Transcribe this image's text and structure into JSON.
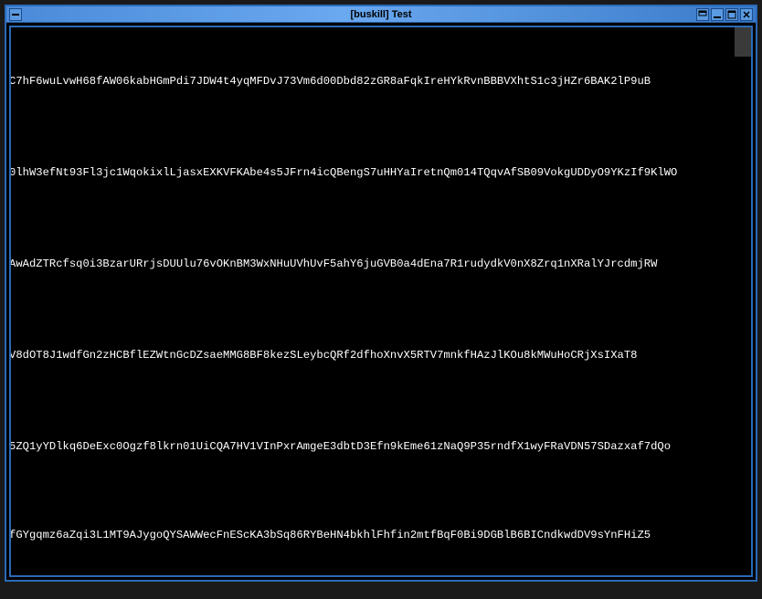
{
  "window": {
    "title": "[buskill] Test"
  },
  "content": {
    "lines": [
      "C7hF6wuLvwH68fAW06kabHGmPdi7JDW4t4yqMFDvJ73Vm6d00Dbd82zGR8aFqkIreHYkRvnBBBVXhtS1c3jHZr6BAK2lP9uB",
      "0lhW3efNt93Fl3jc1WqokixlLjasxEXKVFKAbe4s5JFrn4icQBengS7uHHYaIretnQm014TQqvAfSB09VokgUDDyO9YKzIf9KlWO",
      "AwAdZTRcfsq0i3BzarURrjsDUUlu76vOKnBM3WxNHuUVhUvF5ahY6juGVB0a4dEna7R1rudydkV0nX8Zrq1nXRalYJrcdmjRW",
      "V8dOT8J1wdfGn2zHCBflEZWtnGcDZsaeMMG8BF8kezSLeybcQRf2dfhoXnvX5RTV7mnkfHAzJlKOu8kMWuHoCRjXsIXaT8",
      "5ZQ1yYDlkq6DeExc0Ogzf8lkrn01UiCQA7HV1VInPxrAmgeE3dbtD3Efn9kEme61zNaQ9P35rndfX1wyFRaVDN57SDazxaf7dQo",
      "fGYgqmz6aZqi3L1MT9AJygoQYSAWWecFnEScKA3bSq86RYBeHN4bkhlFhfin2mtfBqF0Bi9DGBlB6BICndkwdDV9sYnFHiZ5"
    ]
  }
}
